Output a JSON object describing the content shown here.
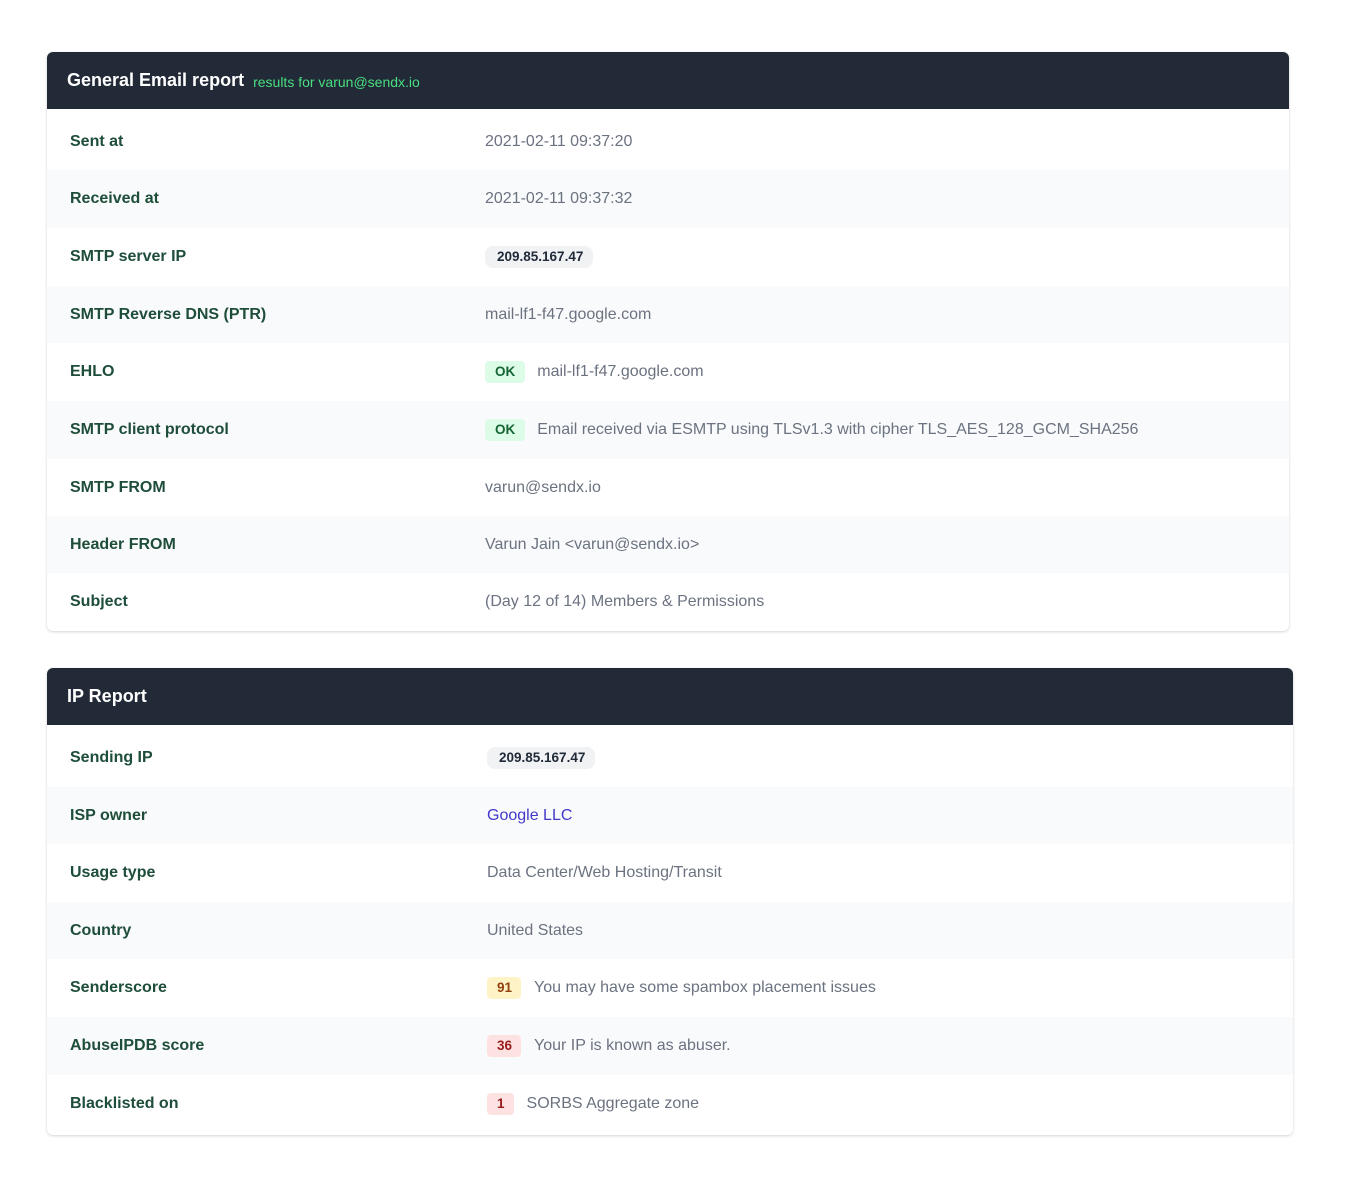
{
  "email_report": {
    "title": "General Email report",
    "subtitle": "results for varun@sendx.io",
    "rows": [
      {
        "label": "Sent at",
        "value": "2021-02-11 09:37:20"
      },
      {
        "label": "Received at",
        "value": "2021-02-11 09:37:32"
      },
      {
        "label": "SMTP server IP",
        "value": "209.85.167.47"
      },
      {
        "label": "SMTP Reverse DNS (PTR)",
        "value": "mail-lf1-f47.google.com"
      },
      {
        "label": "EHLO",
        "badge": "OK",
        "value": "mail-lf1-f47.google.com"
      },
      {
        "label": "SMTP client protocol",
        "badge": "OK",
        "value": "Email received via ESMTP using TLSv1.3 with cipher TLS_AES_128_GCM_SHA256"
      },
      {
        "label": "SMTP FROM",
        "value": "varun@sendx.io"
      },
      {
        "label": "Header FROM",
        "value": "Varun Jain <varun@sendx.io>"
      },
      {
        "label": "Subject",
        "value": "(Day 12 of 14) Members & Permissions"
      }
    ]
  },
  "ip_report": {
    "title": "IP Report",
    "rows": [
      {
        "label": "Sending IP",
        "value": "209.85.167.47"
      },
      {
        "label": "ISP owner",
        "value": "Google LLC"
      },
      {
        "label": "Usage type",
        "value": "Data Center/Web Hosting/Transit"
      },
      {
        "label": "Country",
        "value": "United States"
      },
      {
        "label": "Senderscore",
        "badge": "91",
        "value": "You may have some spambox placement issues"
      },
      {
        "label": "AbuseIPDB score",
        "badge": "36",
        "value": "Your IP is known as abuser."
      },
      {
        "label": "Blacklisted on",
        "badge": "1",
        "value": "SORBS Aggregate zone"
      }
    ]
  },
  "colors": {
    "header_bg": "#222a38",
    "subtitle": "#4ade80",
    "label": "#1e4d3a",
    "value": "#6b7280",
    "link": "#4338ca",
    "ok_bg": "#dcfce7",
    "score_warning_bg": "#fef3c7",
    "score_danger_bg": "#fde2e2"
  }
}
